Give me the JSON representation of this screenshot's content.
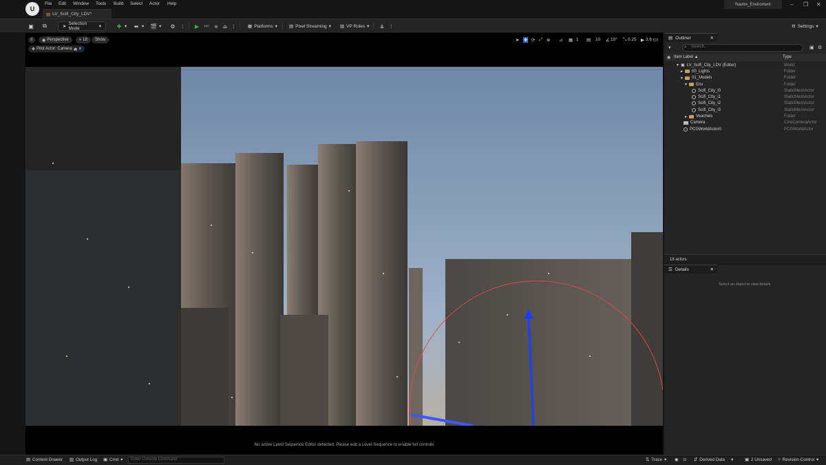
{
  "menu": [
    "File",
    "Edit",
    "Window",
    "Tools",
    "Build",
    "Select",
    "Actor",
    "Help"
  ],
  "document_tab": "LV_Scifi_City_LDV*",
  "project_name": "Nautre_Enviroment",
  "toolbar": {
    "selection_mode": "Selection Mode",
    "platforms": "Platforms",
    "pixel_streaming": "Pixel Streaming",
    "vp_roles": "VP Roles",
    "settings": "Settings"
  },
  "viewport": {
    "perspective": "Perspective",
    "lit": "Lit",
    "show": "Show",
    "pilot_actor": "Pilot Actor: Camera",
    "grid_snap": "10",
    "angle_snap": "10°",
    "scale_snap": "0.25",
    "camera_speed": "3.6",
    "layer_count": "1",
    "status_message": "No active Level Sequence Editor detected. Please edit a Level Sequence to enable full controls"
  },
  "outliner": {
    "tab": "Outliner",
    "search_placeholder": "Search...",
    "col_label": "Item Label ▲",
    "col_type": "Type",
    "rows": [
      {
        "label": "LV_Scifi_City_LDV (Editor)",
        "type": "World"
      },
      {
        "label": "00_Lights",
        "type": "Folder"
      },
      {
        "label": "01_Models",
        "type": "Folder"
      },
      {
        "label": "Env",
        "type": "Folder"
      },
      {
        "label": "Scifi_City_i0",
        "type": "StaticMeshActor"
      },
      {
        "label": "Scifi_City_i1",
        "type": "StaticMeshActor"
      },
      {
        "label": "Scifi_City_i2",
        "type": "StaticMeshActor"
      },
      {
        "label": "Scifi_City_i3",
        "type": "StaticMeshActor"
      },
      {
        "label": "Veachels",
        "type": "Folder"
      },
      {
        "label": "Camera",
        "type": "CineCameraActor"
      },
      {
        "label": "PCGWorldActor0",
        "type": "PCGWorldActor"
      }
    ],
    "actor_count": "16 actors"
  },
  "details": {
    "tab": "Details",
    "empty_message": "Select an object to view details."
  },
  "statusbar": {
    "content_drawer": "Content Drawer",
    "output_log": "Output Log",
    "cmd": "Cmd",
    "console_placeholder": "Enter Console Command",
    "trace": "Trace",
    "derived_data": "Derived Data",
    "unsaved": "2 Unsaved",
    "revision_control": "Revision Control"
  },
  "colors": {
    "play": "#3cb043",
    "accent": "#1f6fd1",
    "folder": "#c9a15a"
  }
}
